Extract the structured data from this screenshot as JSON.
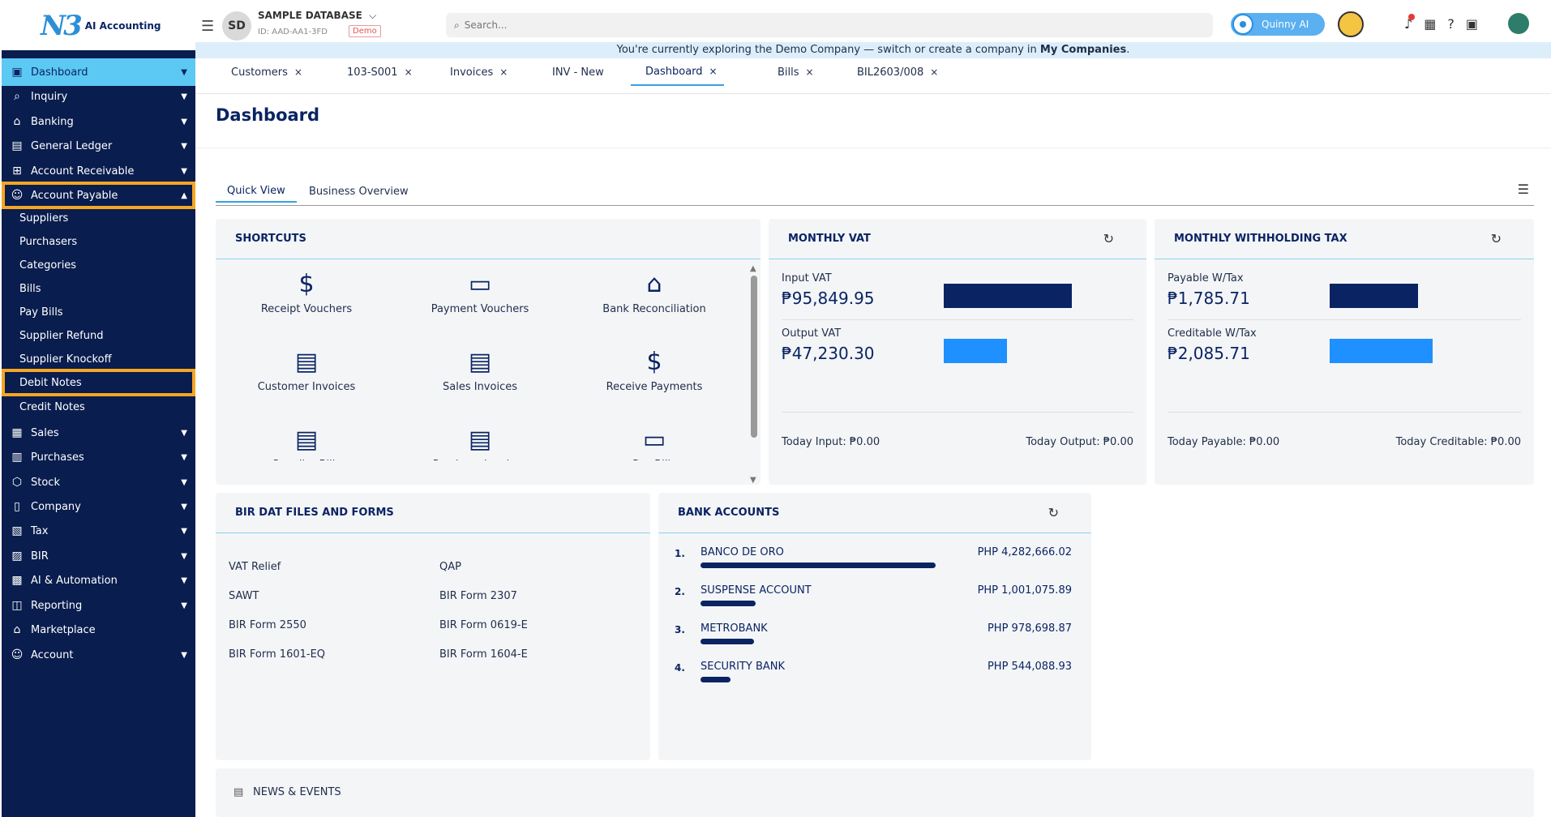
{
  "app": {
    "logo_mark": "N3",
    "logo_text": "AI Accounting",
    "avatar_initials": "SD",
    "db_name": "SAMPLE DATABASE",
    "db_id": "ID: AAD-AA1-3FD",
    "demo_badge": "Demo",
    "search_placeholder": "Search...",
    "assistant_label": "Quinny AI"
  },
  "banner": {
    "text": "You're currently exploring the Demo Company — switch or create a company in",
    "link": "My Companies",
    "end": "."
  },
  "tabs": [
    {
      "label": "Customers",
      "close": "×"
    },
    {
      "label": "103-S001",
      "close": "×"
    },
    {
      "label": "Invoices",
      "close": "×"
    },
    {
      "label": "INV - New",
      "close": ""
    },
    {
      "label": "Dashboard",
      "close": "×"
    },
    {
      "label": "Bills",
      "close": "×"
    },
    {
      "label": "BIL2603/008",
      "close": "×"
    }
  ],
  "sidebar": {
    "items": [
      {
        "label": "Dashboard",
        "icon": "dashboard-icon",
        "glyph": "▣"
      },
      {
        "label": "Inquiry",
        "icon": "inquiry-icon",
        "glyph": "⌕"
      },
      {
        "label": "Banking",
        "icon": "bank-icon",
        "glyph": "⌂"
      },
      {
        "label": "General Ledger",
        "icon": "ledger-icon",
        "glyph": "▤"
      },
      {
        "label": "Account Receivable",
        "icon": "receivable-icon",
        "glyph": "⊞"
      },
      {
        "label": "Account Payable",
        "icon": "payable-icon",
        "glyph": "☺"
      },
      {
        "label": "Sales",
        "icon": "sales-icon",
        "glyph": "▦"
      },
      {
        "label": "Purchases",
        "icon": "purchases-icon",
        "glyph": "▥"
      },
      {
        "label": "Stock",
        "icon": "stock-icon",
        "glyph": "⬡"
      },
      {
        "label": "Company",
        "icon": "company-icon",
        "glyph": "▯"
      },
      {
        "label": "Tax",
        "icon": "tax-icon",
        "glyph": "▧"
      },
      {
        "label": "BIR",
        "icon": "bir-icon",
        "glyph": "▨"
      },
      {
        "label": "AI & Automation",
        "icon": "ai-icon",
        "glyph": "▩"
      },
      {
        "label": "Reporting",
        "icon": "reporting-icon",
        "glyph": "◫"
      },
      {
        "label": "Marketplace",
        "icon": "marketplace-icon",
        "glyph": "⌂"
      },
      {
        "label": "Account",
        "icon": "account-icon",
        "glyph": "☺"
      }
    ],
    "sub_items": [
      "Suppliers",
      "Purchasers",
      "Categories",
      "Bills",
      "Pay Bills",
      "Supplier Refund",
      "Supplier Knockoff",
      "Debit Notes",
      "Credit Notes"
    ]
  },
  "page": {
    "title": "Dashboard",
    "subtabs": [
      "Quick View",
      "Business Overview"
    ]
  },
  "shortcuts": {
    "title": "SHORTCUTS",
    "items": [
      {
        "label": "Receipt Vouchers",
        "icon": "receipt-hand-icon",
        "glyph": "$"
      },
      {
        "label": "Payment Vouchers",
        "icon": "wallet-icon",
        "glyph": "▭"
      },
      {
        "label": "Bank Reconciliation",
        "icon": "bank-building-icon",
        "glyph": "⌂"
      },
      {
        "label": "Customer Invoices",
        "icon": "document-icon",
        "glyph": "▤"
      },
      {
        "label": "Sales Invoices",
        "icon": "document-icon",
        "glyph": "▤"
      },
      {
        "label": "Receive Payments",
        "icon": "receipt-hand-icon",
        "glyph": "$"
      },
      {
        "label": "Supplier Bills",
        "icon": "documents-icon",
        "glyph": "▤"
      },
      {
        "label": "Purchase Invoices",
        "icon": "documents-icon",
        "glyph": "▤"
      },
      {
        "label": "Pay Bills",
        "icon": "wallet-icon",
        "glyph": "▭"
      }
    ]
  },
  "monthly_vat": {
    "title": "MONTHLY VAT",
    "input_label": "Input VAT",
    "input_amount": "₱95,849.95",
    "input_share": 0.67,
    "output_label": "Output VAT",
    "output_amount": "₱47,230.30",
    "output_share": 0.33,
    "today_input": "Today Input: ₱0.00",
    "today_output": "Today Output: ₱0.00",
    "input_color": "#0a2463",
    "output_color": "#1e90ff"
  },
  "withholding": {
    "title": "MONTHLY WITHHOLDING TAX",
    "payable_label": "Payable W/Tax",
    "payable_amount": "₱1,785.71",
    "payable_share": 0.46,
    "creditable_label": "Creditable W/Tax",
    "creditable_amount": "₱2,085.71",
    "creditable_share": 0.54,
    "today_payable": "Today Payable: ₱0.00",
    "today_creditable": "Today Creditable: ₱0.00"
  },
  "bir": {
    "title": "BIR DAT FILES AND FORMS",
    "items": [
      "VAT Relief",
      "QAP",
      "SAWT",
      "BIR Form 2307",
      "BIR Form 2550",
      "BIR Form 0619-E",
      "BIR Form 1601-EQ",
      "BIR Form 1604-E"
    ]
  },
  "bank_accounts": {
    "title": "BANK ACCOUNTS",
    "items": [
      {
        "num": "1.",
        "name": "BANCO DE ORO",
        "amount": "PHP 4,282,666.02",
        "value": 4282666.02
      },
      {
        "num": "2.",
        "name": "SUSPENSE ACCOUNT",
        "amount": "PHP 1,001,075.89",
        "value": 1001075.89
      },
      {
        "num": "3.",
        "name": "METROBANK",
        "amount": "PHP 978,698.87",
        "value": 978698.87
      },
      {
        "num": "4.",
        "name": "SECURITY BANK",
        "amount": "PHP 544,088.93",
        "value": 544088.93
      }
    ]
  },
  "news": {
    "title": "NEWS & EVENTS"
  }
}
